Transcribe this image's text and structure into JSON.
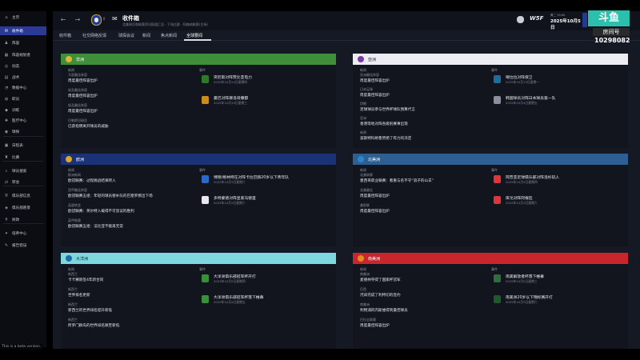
{
  "sidebar": {
    "items": [
      {
        "icon": "home-icon",
        "glyph": "⌂",
        "label": "主页"
      },
      {
        "icon": "inbox-icon",
        "glyph": "✉",
        "label": "收件箱"
      },
      {
        "icon": "squad-icon",
        "glyph": "♟",
        "label": "阵容"
      },
      {
        "icon": "squad-planner-icon",
        "glyph": "▦",
        "label": "阵容规划者"
      },
      {
        "icon": "dynamics-icon",
        "glyph": "◎",
        "label": "动态"
      },
      {
        "icon": "tactics-icon",
        "glyph": "▤",
        "label": "战术"
      },
      {
        "icon": "data-hub-icon",
        "glyph": "◔",
        "label": "数据中心"
      },
      {
        "icon": "staff-icon",
        "glyph": "◍",
        "label": "职员"
      },
      {
        "icon": "training-icon",
        "glyph": "◆",
        "label": "训练"
      },
      {
        "icon": "medical-icon",
        "glyph": "✚",
        "label": "医疗中心"
      },
      {
        "icon": "scouting-icon",
        "glyph": "◉",
        "label": "球探"
      },
      {
        "icon": "schedule-icon",
        "glyph": "▣",
        "label": "日程表"
      },
      {
        "icon": "competitions-icon",
        "glyph": "♜",
        "label": "比赛"
      },
      {
        "icon": "player-search-icon",
        "glyph": "⌕",
        "label": "球员搜索"
      },
      {
        "icon": "transfers-icon",
        "glyph": "⇄",
        "label": "转会"
      },
      {
        "icon": "club-info-icon",
        "glyph": "⛨",
        "label": "俱乐部信息"
      },
      {
        "icon": "club-vision-icon",
        "glyph": "◈",
        "label": "俱乐部愿景"
      },
      {
        "icon": "finances-icon",
        "glyph": "¥",
        "label": "财政"
      },
      {
        "icon": "dev-centre-icon",
        "glyph": "✦",
        "label": "培养中心"
      },
      {
        "icon": "report-icon",
        "glyph": "✎",
        "label": "报告错误"
      }
    ],
    "beta_text": "This is a beta version."
  },
  "header": {
    "title": "收件箱",
    "subtitle": "北美球员和联赛资讯报道汇总 · 下场比赛 · 阿森纳联赛(主场)",
    "brand": "W5F",
    "date_top": "周二 19:00",
    "date_main": "2025年10月5日"
  },
  "overlay": {
    "logo_text": "斗鱼",
    "room_label": "房间号",
    "room_number": "10298082"
  },
  "tabs": [
    "收件箱",
    "社交网络反馈",
    "球探会议",
    "新闻",
    "焦点新闻",
    "全球要闻"
  ],
  "active_tab": 5,
  "panels": {
    "africa": {
      "name": "非洲",
      "color": "#3f8f3a",
      "col_news": "新闻",
      "col_events": "事件",
      "news": [
        {
          "cat": "马里最佳阵容",
          "text": "周度最佳阵容出炉"
        },
        {
          "cat": "埃及最佳阵容",
          "text": "周度最佳阵容出炉"
        },
        {
          "cat": "埃及最佳阵容",
          "text": "周度最佳阵容出炉"
        },
        {
          "cat": "巴勒斯坦球员",
          "text": "已获指明离开球员的威胁"
        }
      ],
      "events": [
        {
          "text": "突尼斯对阵赞比亚电力",
          "date": "2025年10月14日星期四"
        },
        {
          "text": "曼巴对阵摩洛哥撒都",
          "date": "2025年10月15日星期三"
        }
      ]
    },
    "asia": {
      "name": "亚洲",
      "color": "#ececf2",
      "col_news": "新闻",
      "col_events": "事件",
      "news": [
        {
          "cat": "亚洲最佳阵容",
          "text": "周度最佳阵容出炉"
        },
        {
          "cat": "日本足球",
          "text": "周度最佳阵容出炉"
        },
        {
          "cat": "伊朗",
          "text": "足球球员参与世界杯球队预算代言"
        },
        {
          "cat": "亚洲",
          "text": "香港等地对阵各级别赛事出现"
        },
        {
          "cat": "新闻",
          "text": "波斯特科格鲁赞扬了有力的决定"
        }
      ],
      "events": [
        {
          "text": "喀拉拉对阵保卫",
          "date": "2025年10月13日星期一"
        },
        {
          "text": "韩国球员对阵日本球员第一队",
          "date": "2025年10月4日星期五"
        }
      ]
    },
    "europe": {
      "name": "欧洲",
      "color": "#1b3278",
      "col_news": "新闻",
      "col_events": "事件",
      "news": [
        {
          "cat": "欧洲新闻",
          "text": "欧冠联赛：过程挑战结果转入"
        },
        {
          "cat": "西甲最佳阵容",
          "text": "欧冠联赛五组：年轻的球员替补队的巴塞罗那出下场"
        },
        {
          "cat": "英超转会",
          "text": "欧冠联赛：英尔特入载得不可思议的胜利"
        },
        {
          "cat": "英甲联赛",
          "text": "欧冠联赛五组：法比亚不能再无常"
        }
      ],
      "events": [
        {
          "text": "博德/格林特在对阵卡拉巴赫20岁以下青年队",
          "date": "2025年10月3日星期六"
        },
        {
          "text": "多特蒙德对阵皇家马德里",
          "date": "2025年10月3日星期六"
        }
      ]
    },
    "north_america": {
      "name": "北美洲",
      "color": "#2d5f92",
      "col_news": "新闻",
      "col_events": "事件",
      "news": [
        {
          "cat": "北美联赛",
          "text": "墨西哥职业联赛：看重与名不守“浪子的山羊”"
        },
        {
          "cat": "北美最佳",
          "text": "周度最佳阵容出炉"
        },
        {
          "cat": "美职联",
          "text": "周度最佳阵容出炉"
        }
      ],
      "events": [
        {
          "text": "阿普亚足球俱乐部对阵洛杉矶人",
          "date": "2025年10月5日星期四"
        },
        {
          "text": "库戈对阵阿根廷",
          "date": "2025年10月3日星期六"
        }
      ]
    },
    "oceania": {
      "name": "大洋洲",
      "color": "#7fd7de",
      "col_news": "新闻",
      "col_events": "事件",
      "news": [
        {
          "cat": "新西兰",
          "text": "卡卡赛新签4年新合同"
        },
        {
          "cat": "新西兰",
          "text": "世界排名更新"
        },
        {
          "cat": "新西兰",
          "text": "新西兰的世界排名提升新低"
        },
        {
          "cat": "新西兰",
          "text": "所罗门群岛的世界排名跌至新低"
        }
      ],
      "events": [
        {
          "text": "大洋洲俱乐部冠军杯开打",
          "date": "2025年10月5日星期四"
        },
        {
          "text": "大洋洲俱乐部冠军杯落下帷幕",
          "date": "2025年10月4日星期五"
        }
      ]
    },
    "south_america": {
      "name": "南美洲",
      "color": "#c8262c",
      "col_news": "新闻",
      "col_events": "事件",
      "news": [
        {
          "cat": "南美洲",
          "text": "麦德林夺得了国家杯冠军"
        },
        {
          "cat": "巴西",
          "text": "河床完成了利特切的签约"
        },
        {
          "cat": "南美洲",
          "text": "利物浦的内斯维得到最佳球员"
        },
        {
          "cat": "巴拉圭联赛",
          "text": "周度最佳阵容出炉"
        }
      ],
      "events": [
        {
          "text": "南美解放者杯落下帷幕",
          "date": "2025年10月5日星期三"
        },
        {
          "text": "南美洲20岁以下锦标赛开打",
          "date": "2025年10月3日星期六"
        }
      ]
    }
  },
  "colors": {
    "sidebar_active": "#2a3a96",
    "main_bg": "#151923",
    "panel_bg": "#12151d"
  }
}
